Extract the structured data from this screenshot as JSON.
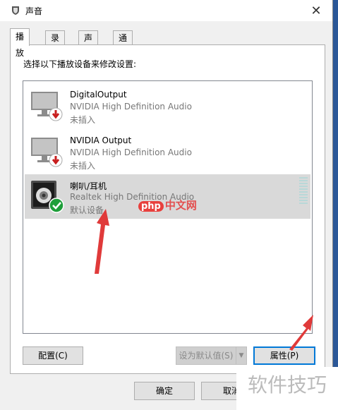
{
  "window": {
    "title": "声音",
    "close_label": "✕"
  },
  "tabs": [
    {
      "label": "播放",
      "active": true
    },
    {
      "label": "录制",
      "active": false
    },
    {
      "label": "声音",
      "active": false
    },
    {
      "label": "通信",
      "active": false
    }
  ],
  "instruction": "选择以下播放设备来修改设置:",
  "devices": [
    {
      "name": "DigitalOutput",
      "driver": "NVIDIA High Definition Audio",
      "status": "未插入",
      "icon": "monitor-icon",
      "badge": "unplugged-arrow-icon",
      "selected": false
    },
    {
      "name": "NVIDIA Output",
      "driver": "NVIDIA High Definition Audio",
      "status": "未插入",
      "icon": "monitor-icon",
      "badge": "unplugged-arrow-icon",
      "selected": false
    },
    {
      "name": "喇叭/耳机",
      "driver": "Realtek High Definition Audio",
      "status": "默认设备",
      "icon": "speaker-icon",
      "badge": "default-check-icon",
      "selected": true
    }
  ],
  "buttons": {
    "configure": "配置(C)",
    "set_default": "设为默认值(S)",
    "properties": "属性(P)",
    "ok": "确定",
    "cancel": "取消"
  },
  "watermarks": {
    "php_oval": "php",
    "php_text": "中文网",
    "tips": "软件技巧"
  },
  "colors": {
    "accent": "#0078d7",
    "selection": "#d9d9d9",
    "annotation_arrow": "#e03a3a",
    "default_badge": "#1e9e3a",
    "unplugged_badge": "#c81e1e"
  }
}
